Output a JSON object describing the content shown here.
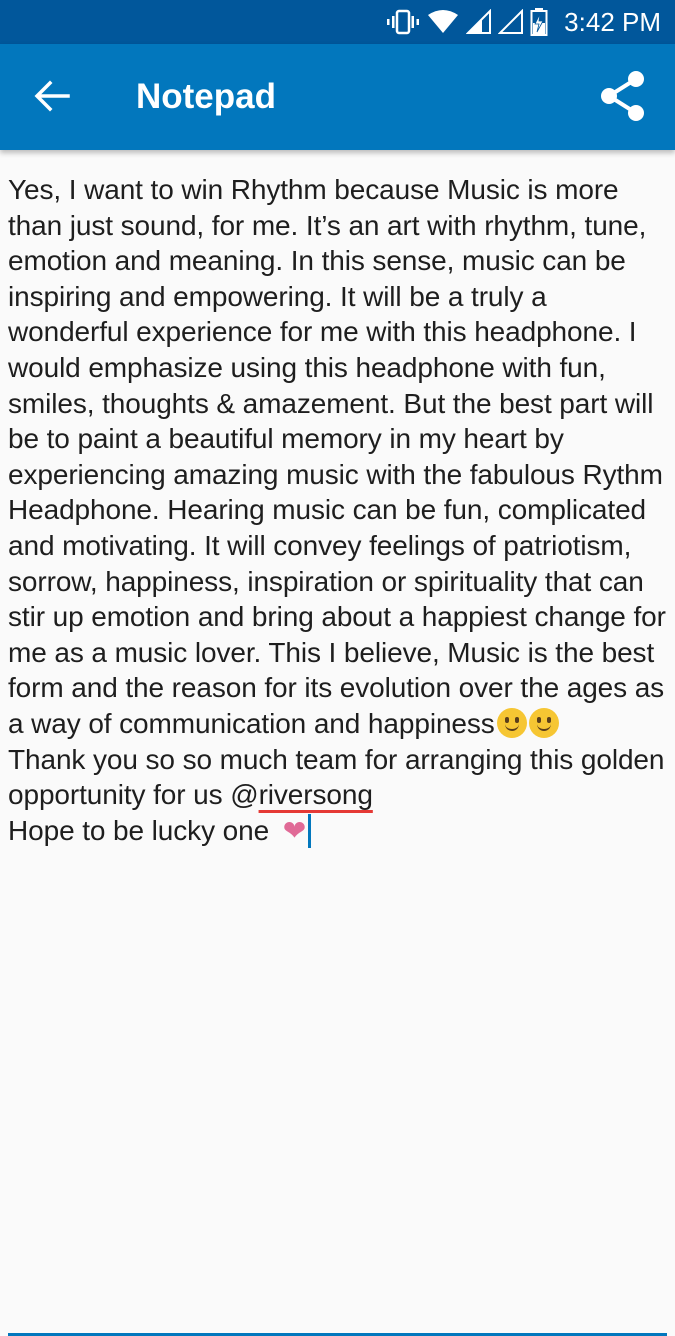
{
  "status_bar": {
    "time": "3:42 PM",
    "icons": [
      "vibrate-icon",
      "wifi-icon",
      "signal-icon",
      "signal-empty-icon",
      "battery-charging-icon"
    ],
    "background": "#01579b"
  },
  "app_bar": {
    "title": "Notepad",
    "back_icon": "arrow-back-icon",
    "share_icon": "share-icon",
    "background": "#0277bd"
  },
  "note": {
    "paragraph": "Yes, I want to win Rhythm because Music is more than just sound, for me. It’s an art with rhythm, tune, emotion and meaning. In this sense, music can be inspiring and empowering. It will be a truly a wonderful experience for me with this headphone. I would emphasize using this headphone with fun, smiles, thoughts & amazement. But the best part will be to paint a beautiful memory in my heart by experiencing amazing music with the fabulous Rythm Headphone. Hearing music can be fun, complicated and motivating. It will convey feelings of patriotism, sorrow, happiness, inspiration or spirituality that can stir up emotion and bring about a happiest change for me as a music lover. This I believe, Music is the best form and the reason for its evolution over the ages as a way of communication and happiness",
    "emoji_after_paragraph": [
      "slightly-smiling-face-icon",
      "slightly-smiling-face-icon"
    ],
    "thanks_line": "Thank you so so much team for arranging this golden opportunity for us @",
    "mention": "riversong",
    "closing_line": "Hope to be lucky one ",
    "closing_emoji": "❤",
    "closing_emoji_icon": "heart-icon",
    "accent_color": "#0277bd",
    "spellcheck_color": "#e53935"
  }
}
